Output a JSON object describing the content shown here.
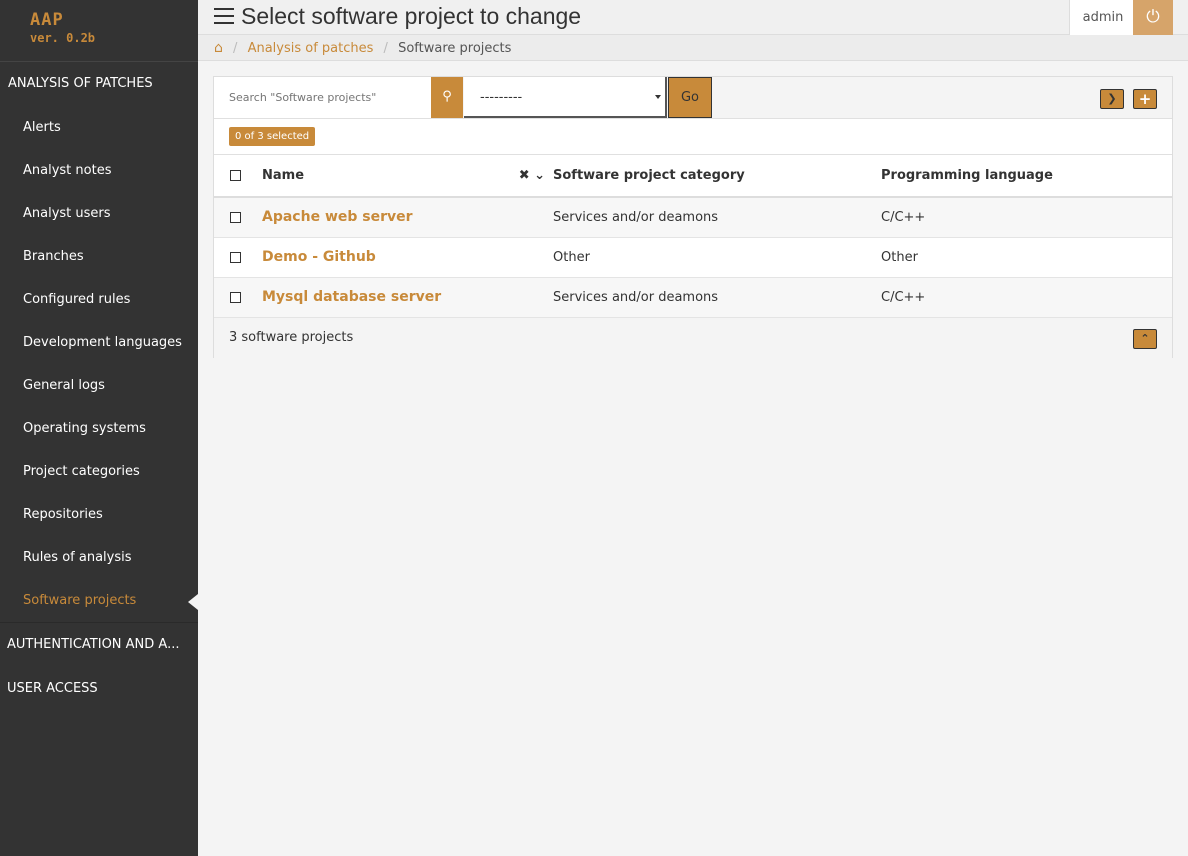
{
  "brand": {
    "name": "AAP",
    "version": "ver. 0.2b"
  },
  "sidebar": {
    "section_analysis": "ANALYSIS OF PATCHES",
    "items": [
      {
        "label": "Alerts"
      },
      {
        "label": "Analyst notes"
      },
      {
        "label": "Analyst users"
      },
      {
        "label": "Branches"
      },
      {
        "label": "Configured rules"
      },
      {
        "label": "Development languages"
      },
      {
        "label": "General logs"
      },
      {
        "label": "Operating systems"
      },
      {
        "label": "Project categories"
      },
      {
        "label": "Repositories"
      },
      {
        "label": "Rules of analysis"
      },
      {
        "label": "Software projects"
      }
    ],
    "section_auth": "AUTHENTICATION AND A...",
    "section_user": "USER ACCESS"
  },
  "header": {
    "title": "Select software project to change",
    "user": "admin",
    "power_icon": "⏻"
  },
  "breadcrumb": {
    "home_icon": "⌂",
    "separator": "/",
    "parent": "Analysis of patches",
    "current": "Software projects"
  },
  "toolbar": {
    "search_placeholder": "Search \"Software projects\"",
    "action_value": "---------",
    "go_label": "Go"
  },
  "selection": {
    "counter": "0 of 3 selected"
  },
  "table": {
    "columns": {
      "name": "Name",
      "category": "Software project category",
      "language": "Programming language"
    },
    "rows": [
      {
        "name": "Apache web server",
        "category": "Services and/or deamons",
        "language": "C/C++"
      },
      {
        "name": "Demo - Github",
        "category": "Other",
        "language": "Other"
      },
      {
        "name": "Mysql database server",
        "category": "Services and/or deamons",
        "language": "C/C++"
      }
    ]
  },
  "footer": {
    "count_text": "3 software projects"
  },
  "colors": {
    "accent": "#c88a3a",
    "sidebar_bg": "#333333",
    "page_bg": "#f4f4f4"
  }
}
